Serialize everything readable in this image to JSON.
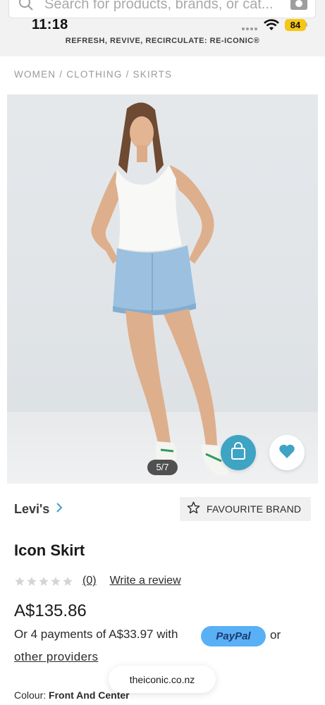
{
  "search": {
    "placeholder": "Search for products, brands, or cat..."
  },
  "status_bar": {
    "time": "11:18",
    "battery": "84"
  },
  "promo_banner": "REFRESH, REVIVE, RECIRCULATE: RE-ICONIC®",
  "breadcrumb": [
    "WOMEN",
    "CLOTHING",
    "SKIRTS"
  ],
  "image_counter": "5/7",
  "brand": {
    "name": "Levi's",
    "favourite_label": "FAVOURITE BRAND"
  },
  "product": {
    "title": "Icon Skirt",
    "rating_stars": 0,
    "review_count": "(0)",
    "write_review": "Write a review",
    "price": "A$135.86",
    "payments_text": "Or 4 payments of A$33.97 with",
    "paypal_label": "PayPal",
    "or_text": "or",
    "other_providers": "other providers",
    "colour_label": "Colour:",
    "colour_value": "Front And Center"
  },
  "browser": {
    "url": "theiconic.co.nz"
  },
  "colors": {
    "accent": "#3fa3c4",
    "paypal": "#5ab0f5",
    "battery": "#f6c614",
    "heart": "#3fa3c4"
  },
  "icons": [
    "search-icon",
    "camera-icon",
    "wifi-icon",
    "shopping-bag-icon",
    "heart-icon",
    "chevron-right-icon",
    "star-outline-icon",
    "star-icon"
  ]
}
